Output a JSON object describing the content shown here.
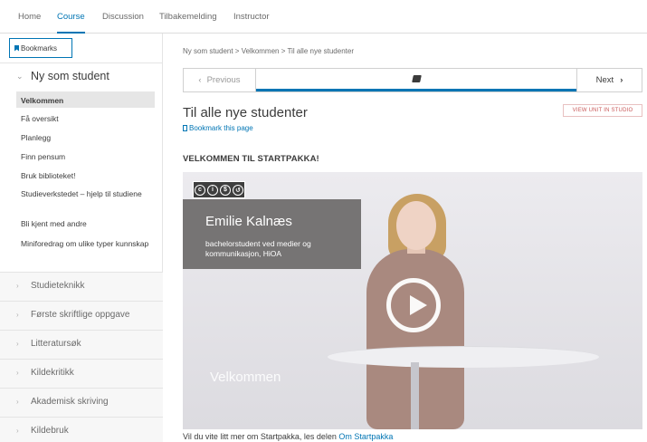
{
  "nav": {
    "tabs": [
      {
        "label": "Home"
      },
      {
        "label": "Course"
      },
      {
        "label": "Discussion"
      },
      {
        "label": "Tilbakemelding"
      },
      {
        "label": "Instructor"
      }
    ],
    "active_tab": "Course"
  },
  "sidebar": {
    "bookmarks_label": "Bookmarks",
    "open_section": {
      "label": "Ny som student",
      "items": [
        {
          "label": "Velkommen"
        },
        {
          "label": "Få oversikt"
        },
        {
          "label": "Planlegg"
        },
        {
          "label": "Finn pensum"
        },
        {
          "label": "Bruk biblioteket!"
        },
        {
          "label": "Studieverkstedet – hjelp til studiene"
        },
        {
          "label": "Bli kjent med andre"
        },
        {
          "label": "Miniforedrag om ulike typer kunnskap"
        }
      ]
    },
    "sections": [
      {
        "label": "Studieteknikk"
      },
      {
        "label": "Første skriftlige oppgave"
      },
      {
        "label": "Litteratursøk"
      },
      {
        "label": "Kildekritikk"
      },
      {
        "label": "Akademisk skriving"
      },
      {
        "label": "Kildebruk"
      }
    ]
  },
  "main": {
    "breadcrumb": "Ny som student > Velkommen > Til alle nye studenter",
    "prev_label": "Previous",
    "next_label": "Next",
    "page_title": "Til alle nye studenter",
    "studio_button": "VIEW UNIT IN STUDIO",
    "bookmark_page": "Bookmark this page",
    "section_title": "VELKOMMEN TIL STARTPAKKA!",
    "video": {
      "name": "Emilie Kalnæs",
      "description": "bachelorstudent ved medier og kommunikasjon, HiOA",
      "title": "Velkommen",
      "license_badge": [
        "cc",
        "by",
        "nc",
        "sa"
      ]
    },
    "caption_text": "Vil du vite litt mer om Startpakka, les delen ",
    "caption_link": "Om Startpakka"
  },
  "colors": {
    "accent": "#0075b4",
    "studio": "#c85a5a"
  }
}
